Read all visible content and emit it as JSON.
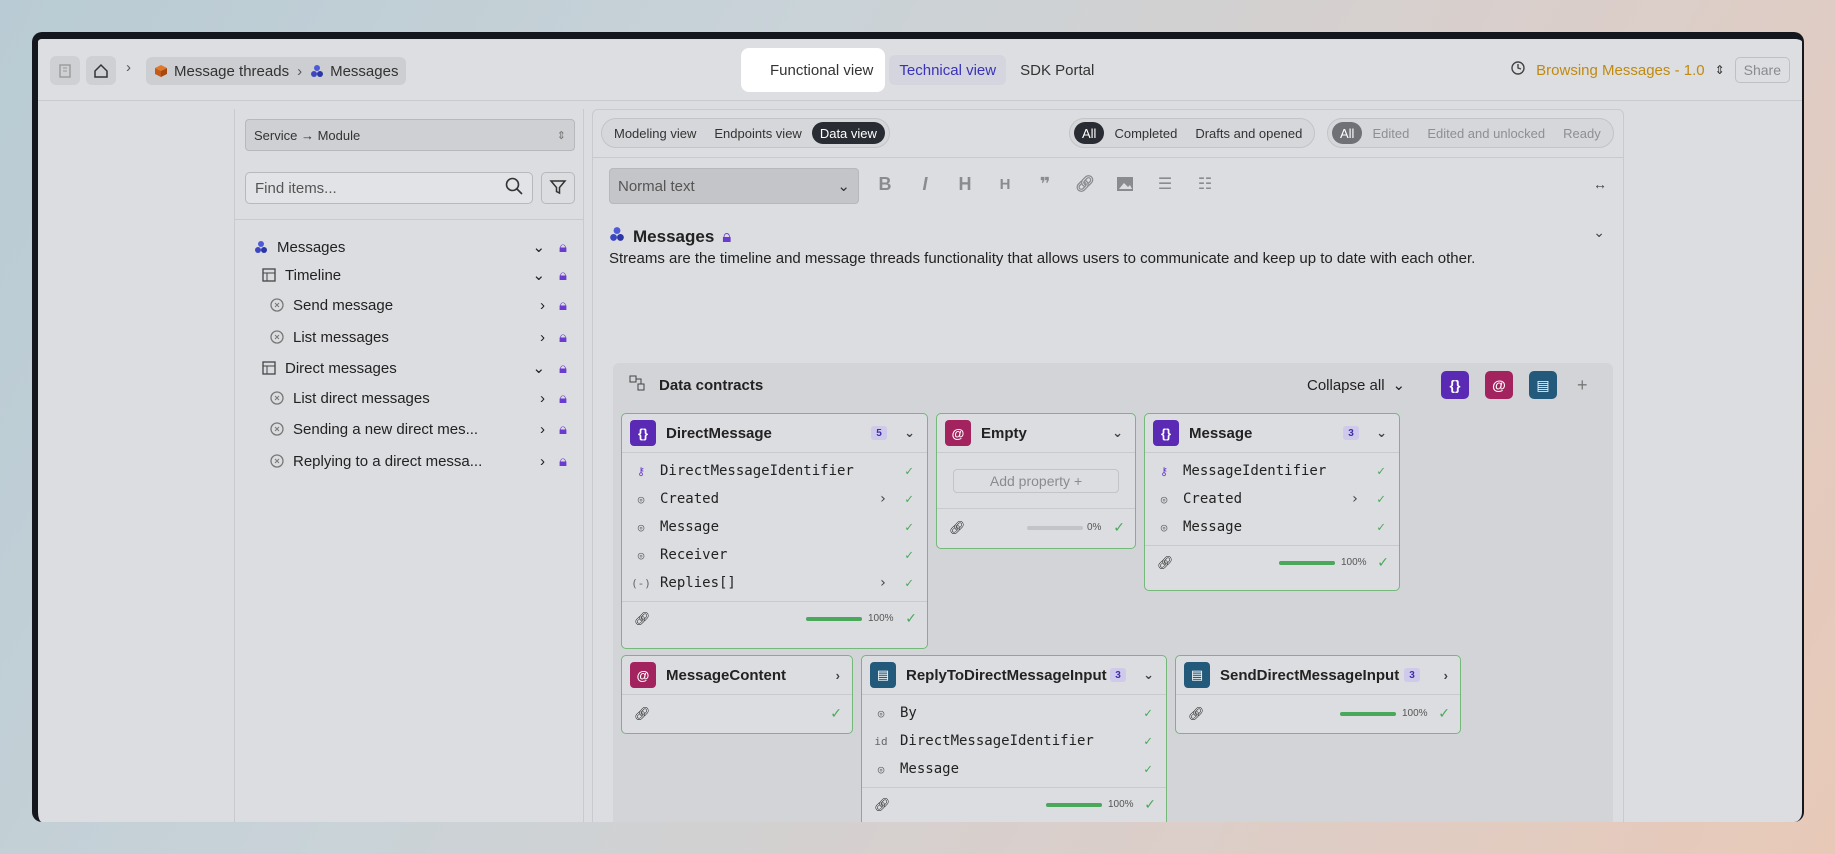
{
  "topbar": {
    "breadcrumb": {
      "parent": "Message threads",
      "current": "Messages"
    },
    "tabs": [
      "Functional view",
      "Technical view",
      "SDK Portal"
    ],
    "browse_label": "Browsing Messages - 1.0",
    "share_label": "Share"
  },
  "sidebar": {
    "selector": "Service → Module",
    "search_placeholder": "Find items...",
    "tree": [
      {
        "label": "Messages",
        "level": 0
      },
      {
        "label": "Timeline",
        "level": 1
      },
      {
        "label": "Send message",
        "level": 2
      },
      {
        "label": "List messages",
        "level": 2
      },
      {
        "label": "Direct messages",
        "level": 1
      },
      {
        "label": "List direct messages",
        "level": 2
      },
      {
        "label": "Sending a new direct mes...",
        "level": 2
      },
      {
        "label": "Replying to a direct messa...",
        "level": 2
      }
    ]
  },
  "main": {
    "view_modes": [
      "Modeling view",
      "Endpoints view",
      "Data view"
    ],
    "status_filters": [
      "All",
      "Completed",
      "Drafts and opened"
    ],
    "edit_filters": [
      "All",
      "Edited",
      "Edited and unlocked",
      "Ready"
    ],
    "text_style": "Normal text",
    "title": "Messages",
    "description": "Streams are the timeline and message threads functionality that allows users to communicate and keep up to date with each other."
  },
  "contracts": {
    "heading": "Data contracts",
    "collapse_label": "Collapse all",
    "cards": {
      "direct_message": {
        "name": "DirectMessage",
        "count": "5",
        "props": [
          "DirectMessageIdentifier",
          "Created",
          "Message",
          "Receiver",
          "Replies[]"
        ],
        "progress": "100%"
      },
      "empty": {
        "name": "Empty",
        "add_label": "Add property",
        "progress": "0%"
      },
      "message": {
        "name": "Message",
        "count": "3",
        "props": [
          "MessageIdentifier",
          "Created",
          "Message"
        ],
        "progress": "100%"
      },
      "message_content": {
        "name": "MessageContent"
      },
      "reply_input": {
        "name": "ReplyToDirectMessageInput",
        "count": "3",
        "props": [
          "By",
          "DirectMessageIdentifier",
          "Message"
        ],
        "progress": "100%"
      },
      "send_input": {
        "name": "SendDirectMessageInput",
        "count": "3",
        "progress": "100%"
      }
    }
  },
  "colors": {
    "accent": "#3a32b8",
    "ok": "#4aa85a",
    "purple": "#5b2ab5",
    "magenta": "#a3235e",
    "teal": "#23597a",
    "warn": "#c08a10"
  }
}
